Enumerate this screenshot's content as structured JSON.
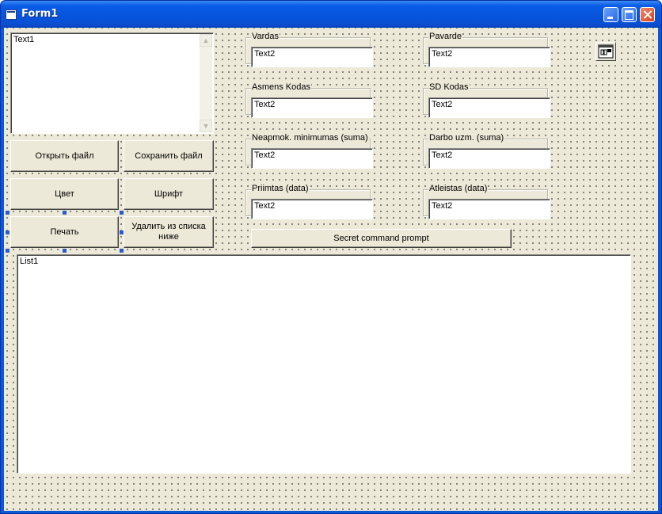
{
  "window": {
    "title": "Form1"
  },
  "text1": {
    "value": "Text1"
  },
  "buttons": {
    "open_file": "Открыть файл",
    "save_file": "Сохранить файл",
    "color": "Цвет",
    "font": "Шрифт",
    "print": "Печать",
    "delete_from_list": "Удалить из списка ниже"
  },
  "fields": {
    "vardas": {
      "label": "Vardas",
      "value": "Text2"
    },
    "pavarde": {
      "label": "Pavarde",
      "value": "Text2"
    },
    "asmens_kodas": {
      "label": "Asmens Kodas",
      "value": "Text2"
    },
    "sd_kodas": {
      "label": "SD Kodas",
      "value": "Text2"
    },
    "neapmok": {
      "label": "Neapmok. minimumas (suma)",
      "value": "Text2"
    },
    "darbo_uzm": {
      "label": "Darbo uzm. (suma)",
      "value": "Text2"
    },
    "priimtas": {
      "label": "Priimtas (data)",
      "value": "Text2"
    },
    "atleistas": {
      "label": "Atleistas (data)",
      "value": "Text2"
    }
  },
  "secret_button": "Secret command prompt",
  "list1": {
    "value": "List1"
  },
  "icons": {
    "timer": "timer-control-icon",
    "scroll_up": "scroll-up-arrow-icon",
    "scroll_down": "scroll-down-arrow-icon"
  }
}
